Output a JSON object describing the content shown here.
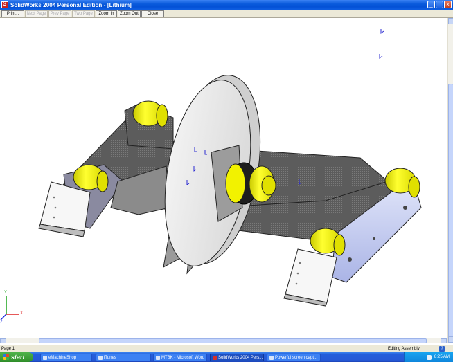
{
  "window": {
    "title": "SolidWorks 2004 Personal Edition - [Lithium]",
    "controls": {
      "minimize": "_",
      "maximize": "□",
      "close": "×"
    }
  },
  "toolbar": {
    "buttons": [
      {
        "label": "Print...",
        "enabled": true
      },
      {
        "label": "Next Page",
        "enabled": false
      },
      {
        "label": "Prev Page",
        "enabled": false
      },
      {
        "label": "Two Page",
        "enabled": false
      },
      {
        "label": "Zoom In",
        "enabled": true
      },
      {
        "label": "Zoom Out",
        "enabled": true
      },
      {
        "label": "Close",
        "enabled": true
      }
    ]
  },
  "viewport": {
    "model": "Lithium robot assembly",
    "triad": {
      "x": "X",
      "y": "Y",
      "z": "Z"
    },
    "colors": {
      "wheel_yellow": "#ffff00",
      "plate_gray": "#5a5a5a",
      "side_blue": "#c8cfee",
      "disc_white": "#eeeeee"
    }
  },
  "statusbar": {
    "left": "Page 1",
    "right": "Editing Assembly",
    "help": "?"
  },
  "taskbar": {
    "start_label": "start",
    "tasks": [
      {
        "label": "eMachineShop",
        "active": false
      },
      {
        "label": "iTunes",
        "active": false
      },
      {
        "label": "MTBK - Microsoft Word",
        "active": false
      },
      {
        "label": "SolidWorks 2004 Pers...",
        "active": true
      },
      {
        "label": "Powerful screen capt...",
        "active": false
      }
    ],
    "clock": "8:25 AM"
  }
}
